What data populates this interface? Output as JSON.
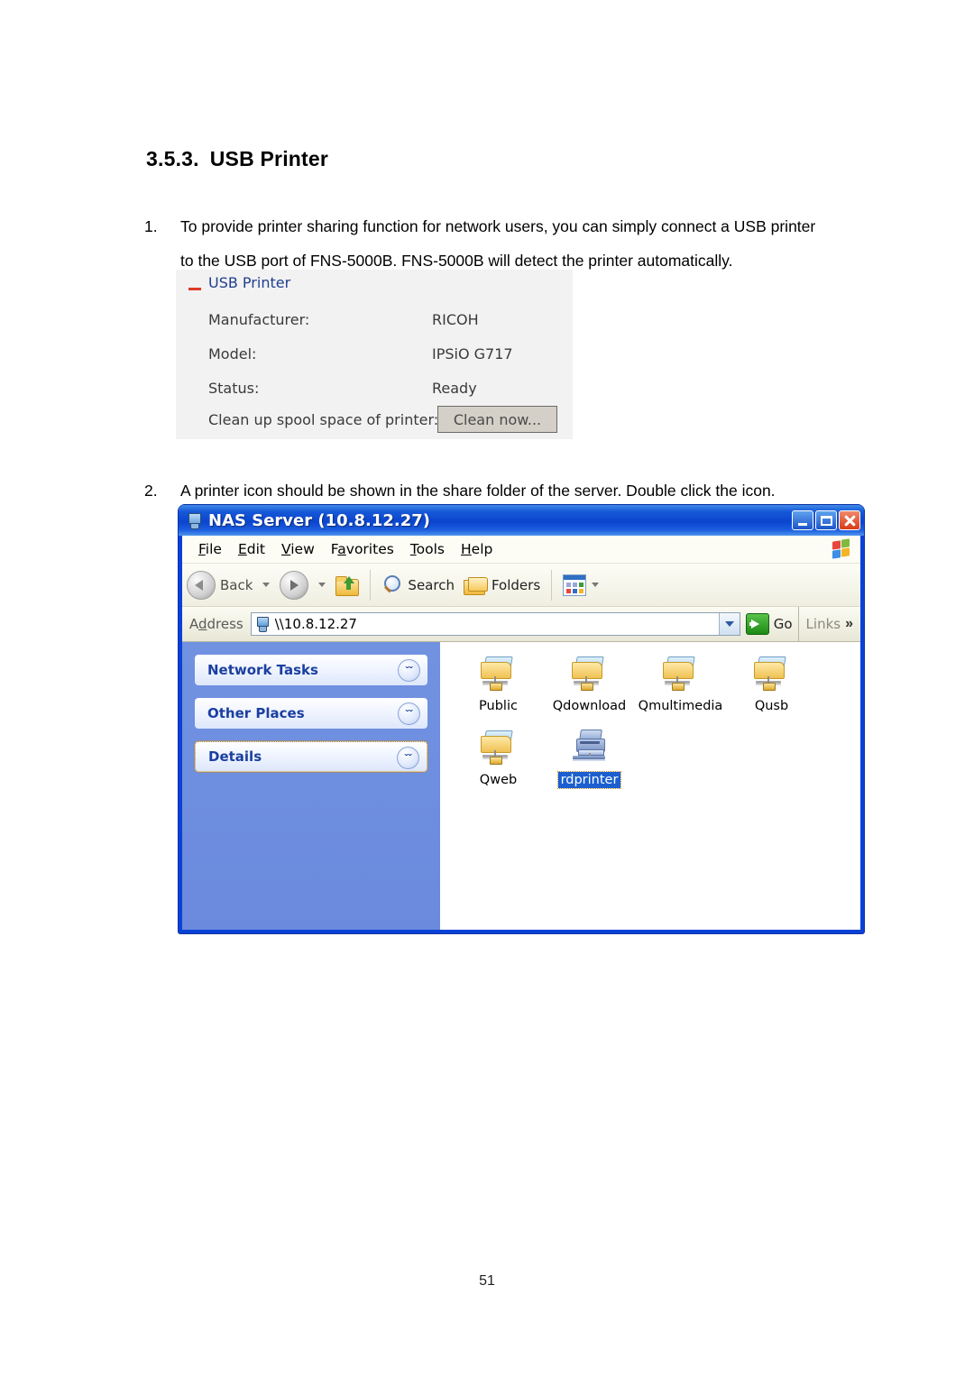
{
  "document": {
    "heading": {
      "number": "3.5.3.",
      "title": "USB Printer"
    },
    "steps": [
      {
        "index": "1.",
        "text": "To provide printer sharing function for network users, you can simply connect a USB printer to the USB port of FNS-5000B.  FNS-5000B will detect the printer automatically."
      },
      {
        "index": "2.",
        "text": "A printer icon should be shown in the share folder of the server.  Double click the icon."
      }
    ],
    "page_number": "51"
  },
  "usb_printer_panel": {
    "section_title": "USB Printer",
    "collapse_toggle": "−",
    "rows": [
      {
        "label": "Manufacturer:",
        "value": "RICOH"
      },
      {
        "label": "Model:",
        "value": "IPSiO G717"
      },
      {
        "label": "Status:",
        "value": "Ready"
      }
    ],
    "clean_label": "Clean up spool space of printer:",
    "clean_button": "Clean now...",
    "colors": {
      "panel_bg": "#f2f2f2",
      "title": "#1f3f8f",
      "minus": "#e03a26",
      "button_face": "#d4d0c8"
    }
  },
  "explorer_window": {
    "title": "NAS Server (10.8.12.27)",
    "window_buttons": {
      "minimize": "Minimize",
      "maximize": "Maximize",
      "close": "Close"
    },
    "menu": [
      "File",
      "Edit",
      "View",
      "Favorites",
      "Tools",
      "Help"
    ],
    "menu_accel": [
      "F",
      "E",
      "V",
      "a",
      "T",
      "H"
    ],
    "toolbar": {
      "back": "Back",
      "forward": "",
      "up": "",
      "search": "Search",
      "folders": "Folders",
      "views": ""
    },
    "address": {
      "label": "Address",
      "value": "\\\\10.8.12.27",
      "go_label": "Go",
      "links_label": "Links",
      "links_chevron": "»"
    },
    "sidebar": {
      "panels": [
        {
          "label": "Network Tasks",
          "chevron": "ˇˇ",
          "focused": false
        },
        {
          "label": "Other Places",
          "chevron": "ˇˇ",
          "focused": false
        },
        {
          "label": "Details",
          "chevron": "ˇˇ",
          "focused": true
        }
      ]
    },
    "items": [
      {
        "label": "Public",
        "type": "network-folder",
        "selected": false
      },
      {
        "label": "Qdownload",
        "type": "network-folder",
        "selected": false
      },
      {
        "label": "Qmultimedia",
        "type": "network-folder",
        "selected": false
      },
      {
        "label": "Qusb",
        "type": "network-folder",
        "selected": false
      },
      {
        "label": "Qweb",
        "type": "network-folder",
        "selected": false
      },
      {
        "label": "rdprinter",
        "type": "network-printer",
        "selected": true
      }
    ],
    "colors": {
      "titlebar": "#0b45ce",
      "frame": "#0a41d6",
      "sidebar": "#6f8fe0",
      "selection": "#1b5fd0"
    }
  }
}
